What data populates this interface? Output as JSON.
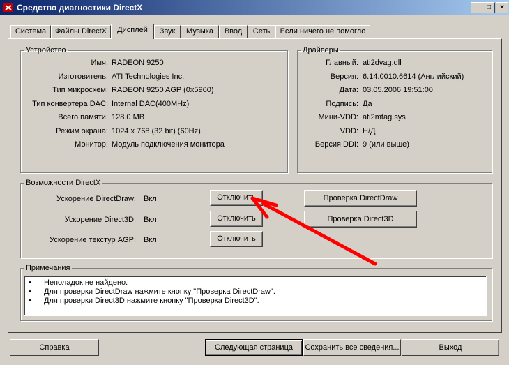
{
  "window": {
    "title": "Средство диагностики DirectX",
    "controls": [
      "_",
      "□",
      "×"
    ]
  },
  "tabs": [
    {
      "label": "Система",
      "active": false
    },
    {
      "label": "Файлы DirectX",
      "active": false
    },
    {
      "label": "Дисплей",
      "active": true
    },
    {
      "label": "Звук",
      "active": false
    },
    {
      "label": "Музыка",
      "active": false
    },
    {
      "label": "Ввод",
      "active": false
    },
    {
      "label": "Сеть",
      "active": false
    },
    {
      "label": "Если ничего не помогло",
      "active": false
    }
  ],
  "device": {
    "legend": "Устройство",
    "rows": [
      {
        "label": "Имя:",
        "value": "RADEON 9250"
      },
      {
        "label": "Изготовитель:",
        "value": "ATI Technologies Inc."
      },
      {
        "label": "Тип микросхем:",
        "value": "RADEON 9250 AGP (0x5960)"
      },
      {
        "label": "Тип конвертера DAC:",
        "value": "Internal DAC(400MHz)"
      },
      {
        "label": "Всего памяти:",
        "value": "128.0 MB"
      },
      {
        "label": "Режим экрана:",
        "value": "1024 x 768 (32 bit) (60Hz)"
      },
      {
        "label": "Монитор:",
        "value": "Модуль подключения монитора"
      }
    ]
  },
  "drivers": {
    "legend": "Драйверы",
    "rows": [
      {
        "label": "Главный:",
        "value": "ati2dvag.dll"
      },
      {
        "label": "Версия:",
        "value": "6.14.0010.6614 (Английский)"
      },
      {
        "label": "Дата:",
        "value": "03.05.2006 19:51:00"
      },
      {
        "label": "Подпись:",
        "value": "Да"
      },
      {
        "label": "Мини-VDD:",
        "value": "ati2mtag.sys"
      },
      {
        "label": "VDD:",
        "value": "Н/Д"
      },
      {
        "label": "Версия DDI:",
        "value": "9 (или выше)"
      }
    ]
  },
  "directx": {
    "legend": "Возможности DirectX",
    "rows": [
      {
        "label": "Ускорение DirectDraw:",
        "value": "Вкл",
        "button": "Отключить"
      },
      {
        "label": "Ускорение Direct3D:",
        "value": "Вкл",
        "button": "Отключить"
      },
      {
        "label": "Ускорение текстур AGP:",
        "value": "Вкл",
        "button": "Отключить"
      }
    ],
    "test_directdraw": "Проверка DirectDraw",
    "test_direct3d": "Проверка Direct3D"
  },
  "notes": {
    "legend": "Примечания",
    "items": [
      "Неполадок не найдено.",
      "Для проверки DirectDraw нажмите кнопку \"Проверка DirectDraw\".",
      "Для проверки Direct3D нажмите кнопку \"Проверка Direct3D\"."
    ]
  },
  "bottom": {
    "help": "Справка",
    "next": "Следующая страница",
    "save": "Сохранить все сведения...",
    "exit": "Выход"
  },
  "colors": {
    "face": "#d4d0c8",
    "title_start": "#0a246a",
    "title_end": "#a6caf0",
    "annotation_arrow": "#ff0000"
  }
}
